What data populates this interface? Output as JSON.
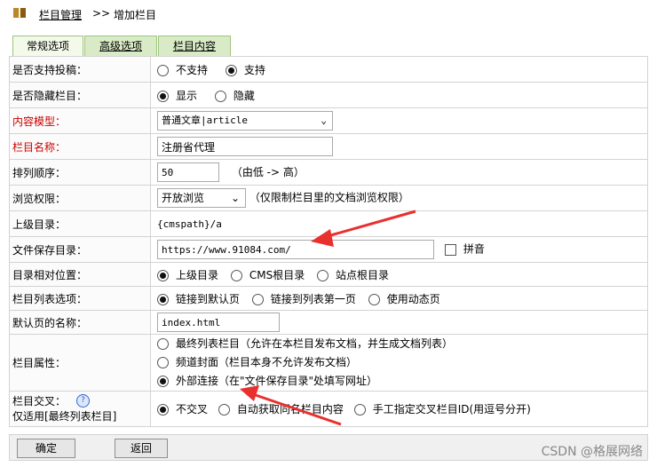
{
  "breadcrumb": {
    "parent": "栏目管理",
    "separator": ">>",
    "current": "增加栏目"
  },
  "tabs": [
    "常规选项",
    "高级选项",
    "栏目内容"
  ],
  "rows": {
    "allow_submit": {
      "label": "是否支持投稿：",
      "options": [
        "不支持",
        "支持"
      ]
    },
    "hide": {
      "label": "是否隐藏栏目：",
      "options": [
        "显示",
        "隐藏"
      ]
    },
    "model": {
      "label": "内容模型：",
      "value": "普通文章|article"
    },
    "name": {
      "label": "栏目名称：",
      "value": "注册省代理"
    },
    "order": {
      "label": "排列顺序：",
      "value": "50",
      "hint": "（由低 -> 高）"
    },
    "access": {
      "label": "浏览权限：",
      "value": "开放浏览",
      "hint": "（仅限制栏目里的文档浏览权限）"
    },
    "parent_dir": {
      "label": "上级目录：",
      "value": "{cmspath}/a"
    },
    "save_dir": {
      "label": "文件保存目录：",
      "value": "https://www.91084.com/",
      "pinyin": "拼音"
    },
    "dir_pos": {
      "label": "目录相对位置：",
      "options": [
        "上级目录",
        "CMS根目录",
        "站点根目录"
      ]
    },
    "list_opt": {
      "label": "栏目列表选项：",
      "options": [
        "链接到默认页",
        "链接到列表第一页",
        "使用动态页"
      ]
    },
    "default_page": {
      "label": "默认页的名称：",
      "value": "index.html"
    },
    "attr": {
      "label": "栏目属性：",
      "options": [
        "最终列表栏目（允许在本栏目发布文档，并生成文档列表）",
        "频道封面（栏目本身不允许发布文档）",
        "外部连接（在\"文件保存目录\"处填写网址）"
      ]
    },
    "cross": {
      "label": "栏目交叉：",
      "sub_label": "仅适用[最终列表栏目]",
      "options": [
        "不交叉",
        "自动获取同名栏目内容",
        "手工指定交叉栏目ID(用逗号分开)"
      ]
    }
  },
  "buttons": {
    "ok": "确定",
    "back": "返回"
  },
  "watermark": "CSDN @格展网络",
  "colors": {
    "required_label": "#cc0000",
    "tab_bg": "#d9ebc6",
    "annotation_arrow": "#e8302e"
  }
}
